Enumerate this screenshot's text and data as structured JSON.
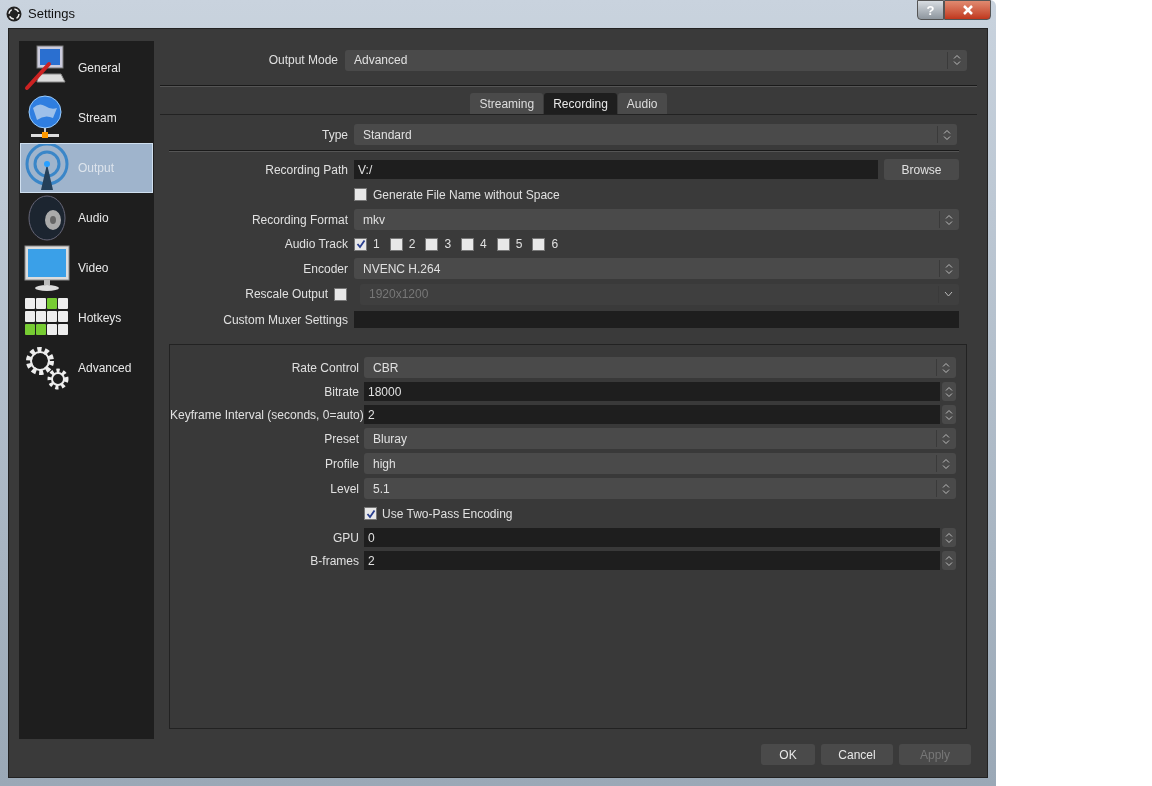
{
  "window": {
    "title": "Settings",
    "help": "?"
  },
  "sidebar": {
    "items": [
      {
        "label": "General",
        "kind": "general",
        "selected": false
      },
      {
        "label": "Stream",
        "kind": "stream",
        "selected": false
      },
      {
        "label": "Output",
        "kind": "output",
        "selected": true
      },
      {
        "label": "Audio",
        "kind": "audio",
        "selected": false
      },
      {
        "label": "Video",
        "kind": "video",
        "selected": false
      },
      {
        "label": "Hotkeys",
        "kind": "hotkeys",
        "selected": false
      },
      {
        "label": "Advanced",
        "kind": "advanced",
        "selected": false
      }
    ]
  },
  "output_mode": {
    "label": "Output Mode",
    "value": "Advanced"
  },
  "tabs": [
    {
      "label": "Streaming",
      "selected": false
    },
    {
      "label": "Recording",
      "selected": true
    },
    {
      "label": "Audio",
      "selected": false
    }
  ],
  "type": {
    "label": "Type",
    "value": "Standard"
  },
  "recording": [
    {
      "kind": "path",
      "label": "Recording Path",
      "value": "V:/",
      "button": "Browse"
    },
    {
      "kind": "checkbox",
      "label": "Generate File Name without Space",
      "checked": false
    },
    {
      "kind": "select",
      "label": "Recording Format",
      "value": "mkv"
    },
    {
      "kind": "tracks",
      "label": "Audio Track",
      "tracks": [
        {
          "label": "1",
          "checked": true
        },
        {
          "label": "2",
          "checked": false
        },
        {
          "label": "3",
          "checked": false
        },
        {
          "label": "4",
          "checked": false
        },
        {
          "label": "5",
          "checked": false
        },
        {
          "label": "6",
          "checked": false
        }
      ]
    },
    {
      "kind": "select",
      "label": "Encoder",
      "value": "NVENC H.264"
    },
    {
      "kind": "rescale",
      "label": "Rescale Output",
      "checked": false,
      "value": "1920x1200"
    },
    {
      "kind": "text",
      "label": "Custom Muxer Settings"
    }
  ],
  "encoder_settings": [
    {
      "kind": "select",
      "label": "Rate Control",
      "value": "CBR"
    },
    {
      "kind": "spin",
      "label": "Bitrate",
      "value": "18000"
    },
    {
      "kind": "spin",
      "label": "Keyframe Interval (seconds, 0=auto)",
      "value": "2"
    },
    {
      "kind": "select",
      "label": "Preset",
      "value": "Bluray"
    },
    {
      "kind": "select",
      "label": "Profile",
      "value": "high"
    },
    {
      "kind": "select",
      "label": "Level",
      "value": "5.1"
    },
    {
      "kind": "checkbox",
      "label": "Use Two-Pass Encoding",
      "checked": true
    },
    {
      "kind": "spin",
      "label": "GPU",
      "value": "0"
    },
    {
      "kind": "spin",
      "label": "B-frames",
      "value": "2"
    }
  ],
  "buttons": [
    {
      "label": "OK",
      "disabled": false
    },
    {
      "label": "Cancel",
      "disabled": false
    },
    {
      "label": "Apply",
      "disabled": true
    }
  ]
}
